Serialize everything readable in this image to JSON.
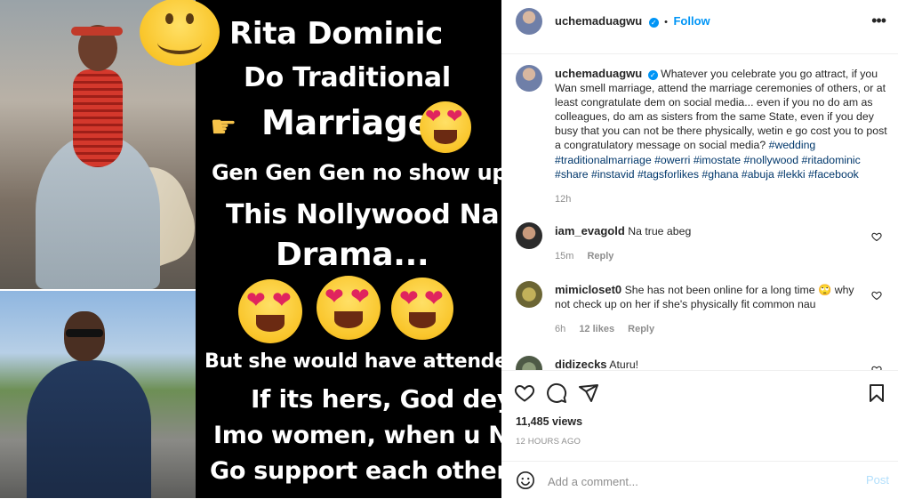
{
  "media": {
    "lines": {
      "line1": "Rita Dominic",
      "line2": "Do Traditional",
      "line3": "Marriage",
      "line4": "Gen Gen Gen no show up",
      "line5": "This Nollywood Na",
      "line6": "Drama...",
      "line7": "But she would have attended",
      "line8": "If its hers, God dey",
      "line9": "Imo women, when u Na",
      "line10": "Go support each other?"
    }
  },
  "header": {
    "username": "uchemaduagwu",
    "separator": "•",
    "follow_label": "Follow",
    "verified_mark": "✓"
  },
  "caption": {
    "username": "uchemaduagwu",
    "text": "Whatever you celebrate you go attract, if you Wan smell marriage, attend the marriage ceremonies of others, or at least congratulate dem on social media... even if you no do am as colleagues, do am as sisters from the same State, even if you dey busy that you can not be there physically, wetin e go cost you to post a congratulatory message on social media?",
    "hashtags": "#wedding #traditionalmarriage #owerri #imostate #nollywood #ritadominic #share #instavid #tagsforlikes #ghana #abuja #lekki #facebook",
    "time": "12h"
  },
  "comments": [
    {
      "username": "iam_evagold",
      "text": "Na true abeg",
      "time": "15m",
      "likes": "",
      "reply": "Reply"
    },
    {
      "username": "mimicloset0",
      "text": "She has not been online for a long time 🙄 why not check up on her if she's physically fit common nau",
      "time": "6h",
      "likes": "12 likes",
      "reply": "Reply"
    },
    {
      "username": "didizecks",
      "text": "Aturu!",
      "time": "",
      "likes": "",
      "reply": ""
    }
  ],
  "stats": {
    "views": "11,485 views",
    "time_ago": "12 HOURS AGO"
  },
  "composer": {
    "placeholder": "Add a comment...",
    "post_label": "Post"
  },
  "colors": {
    "accent": "#0095f6",
    "hashtag": "#00376b",
    "muted": "#8e8e8e",
    "border": "#efefef",
    "post_disabled": "#b2dffc"
  },
  "icons": {
    "header_more": "more-horizontal-icon",
    "like": "heart-icon",
    "comment": "comment-bubble-icon",
    "share": "paper-plane-icon",
    "save": "bookmark-icon",
    "emoji": "smiley-icon"
  }
}
